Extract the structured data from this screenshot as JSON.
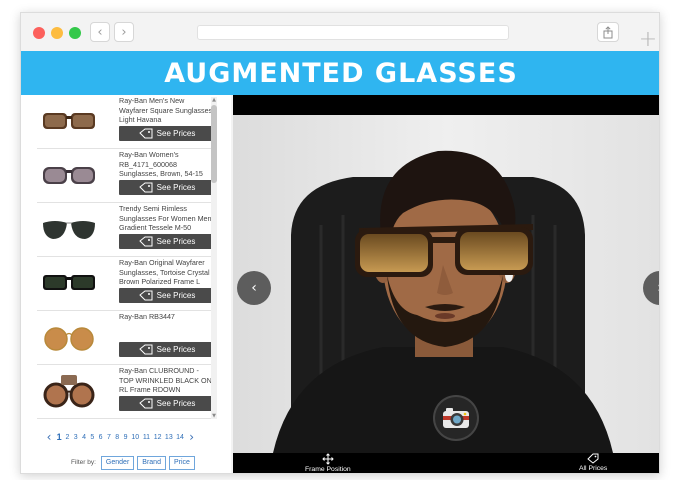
{
  "app": {
    "title": "AUGMENTED GLASSES",
    "header_color": "#2fb5f0"
  },
  "browser": {
    "nav_back_icon": "chevron-left-icon",
    "nav_forward_icon": "chevron-right-icon",
    "share_icon": "share-icon",
    "new_tab_icon": "plus-icon"
  },
  "products": [
    {
      "name": "Ray-Ban Men's New Wayfarer Square Sunglasses, Light Havana",
      "price_label": "See Prices",
      "icon": "tag-icon"
    },
    {
      "name": "Ray-Ban Women's RB_4171_600068 Sunglasses, Brown, 54-15",
      "price_label": "See Prices",
      "icon": "tag-icon"
    },
    {
      "name": "Trendy Semi Rimless Sunglasses For Women Men Gradient Tessele M-50",
      "price_label": "See Prices",
      "icon": "tag-icon"
    },
    {
      "name": "Ray-Ban Original Wayfarer Sunglasses, Tortoise Crystal Brown Polarized Frame L",
      "price_label": "See Prices",
      "icon": "tag-icon"
    },
    {
      "name": "Ray-Ban RB3447",
      "price_label": "See Prices",
      "icon": "tag-icon"
    },
    {
      "name": "Ray-Ban CLUBROUND - TOP WRINKLED BLACK ON RL Frame RDOWN",
      "price_label": "See Prices",
      "icon": "tag-icon"
    }
  ],
  "pagination": {
    "prev_icon": "chevron-left-icon",
    "next_icon": "chevron-right-icon",
    "current": "1",
    "pages": [
      "1",
      "2",
      "3",
      "4",
      "5",
      "6",
      "7",
      "8",
      "9",
      "10",
      "11",
      "12",
      "13",
      "14"
    ]
  },
  "filters": {
    "label": "Filter by:",
    "options": [
      "Gender",
      "Brand",
      "Price"
    ]
  },
  "camera": {
    "prev_icon": "chevron-left-icon",
    "next_icon": "chevron-right-icon",
    "capture_icon": "camera-icon",
    "footer": {
      "frame_position": "Frame Position",
      "frame_icon": "move-icon",
      "all_prices": "All Prices",
      "all_prices_icon": "tag-icon"
    }
  }
}
